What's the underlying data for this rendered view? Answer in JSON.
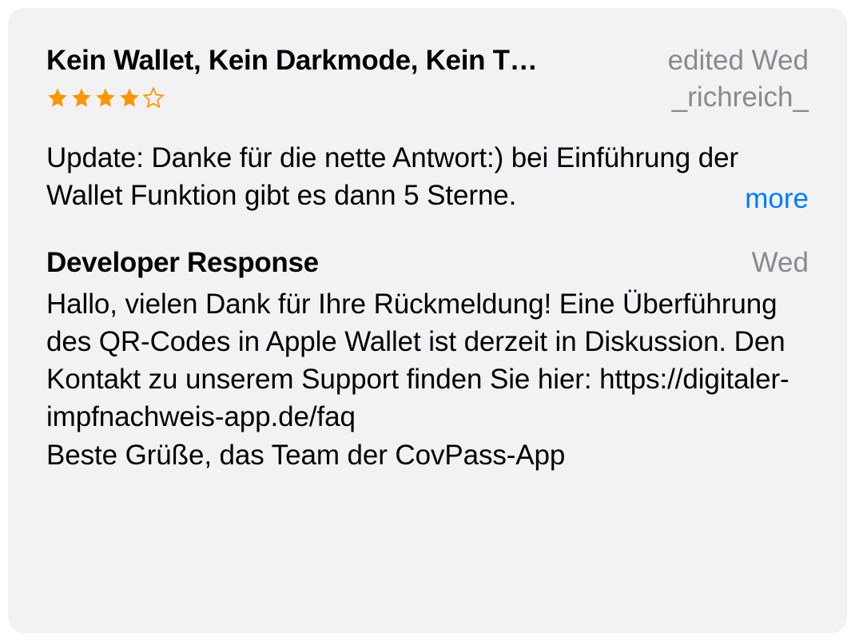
{
  "review": {
    "title": "Kein Wallet, Kein Darkmode, Kein T…",
    "edited_label": "edited Wed",
    "rating": 4,
    "max_rating": 5,
    "reviewer": "_richreich_",
    "body": "Update: Danke für die nette Antwort:) bei Einführung der Wallet Funktion gibt es dann 5 Sterne.",
    "more_label": "more"
  },
  "response": {
    "heading": "Developer Response",
    "date_label": "Wed",
    "body": "Hallo, vielen Dank für Ihre Rückmeldung! Eine Überführung des QR-Codes in Apple Wallet ist derzeit in Diskussion. Den Kontakt zu unserem Support finden Sie hier: https://digitaler-impfnachweis-app.de/faq\nBeste Grüße, das Team der CovPass-App"
  }
}
